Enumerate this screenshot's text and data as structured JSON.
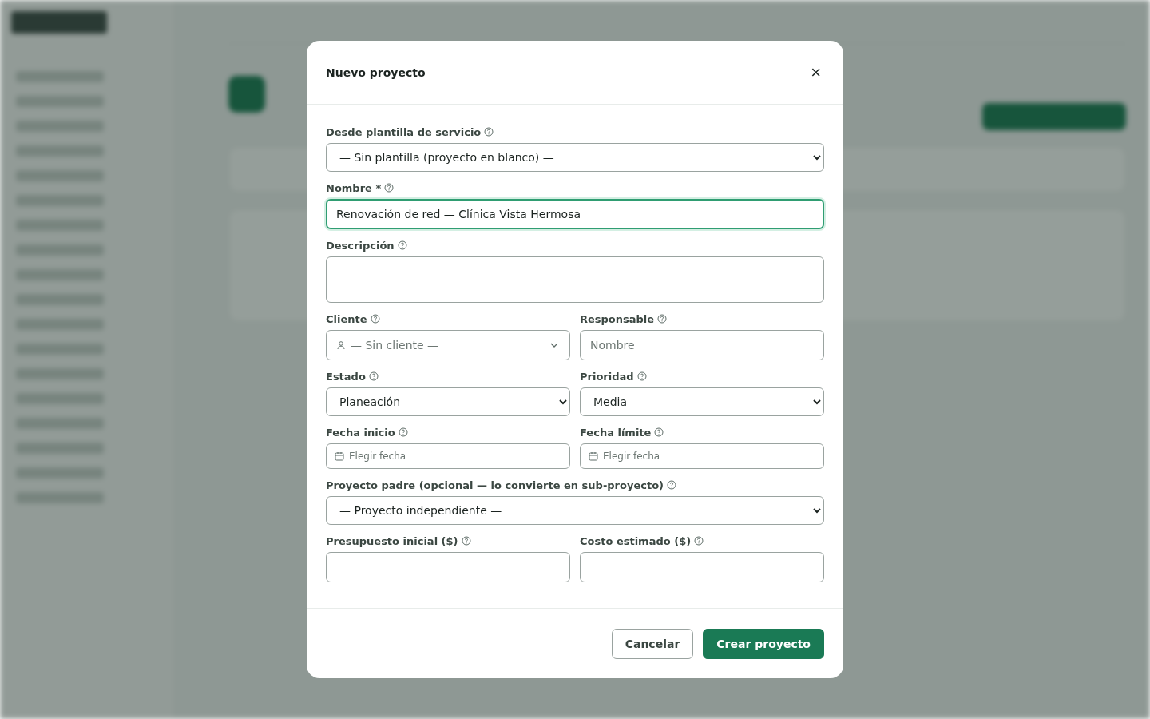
{
  "dialog": {
    "title": "Nuevo proyecto",
    "close": "×",
    "rows": [
      [
        {
          "kind": "select",
          "label": "Desde plantilla de servicio",
          "value": "— Sin plantilla (proyecto en blanco) —"
        }
      ],
      [
        {
          "kind": "text",
          "label": "Nombre *",
          "value": "Renovación de red — Clínica Vista Hermosa",
          "focused": true
        }
      ],
      [
        {
          "kind": "textarea",
          "label": "Descripción"
        }
      ],
      [
        {
          "kind": "combo",
          "label": "Cliente",
          "placeholder": "— Sin cliente —"
        },
        {
          "kind": "text",
          "label": "Responsable",
          "placeholder": "Nombre",
          "focused": false
        }
      ],
      [
        {
          "kind": "select",
          "label": "Estado",
          "value": "Planeación"
        },
        {
          "kind": "select",
          "label": "Prioridad",
          "value": "Media"
        }
      ],
      [
        {
          "kind": "date",
          "label": "Fecha inicio",
          "placeholder": "Elegir fecha"
        },
        {
          "kind": "date",
          "label": "Fecha límite",
          "placeholder": "Elegir fecha"
        }
      ],
      [
        {
          "kind": "select",
          "label": "Proyecto padre (opcional — lo convierte en sub-proyecto)",
          "value": "— Proyecto independiente —"
        }
      ],
      [
        {
          "kind": "text",
          "label": "Presupuesto inicial ($)",
          "focused": false
        },
        {
          "kind": "text",
          "label": "Costo estimado ($)",
          "focused": false
        }
      ]
    ],
    "buttons": [
      {
        "label": "Cancelar",
        "kind": "secondary"
      },
      {
        "label": "Crear proyecto",
        "kind": "primary"
      }
    ]
  }
}
